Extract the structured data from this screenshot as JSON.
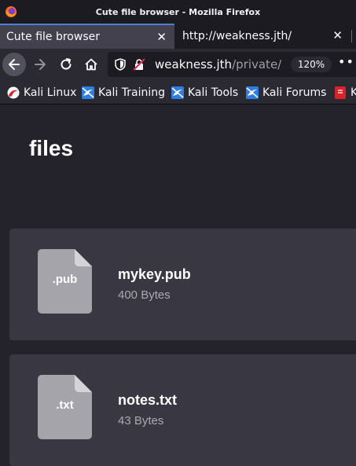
{
  "window": {
    "title": "Cute file browser - Mozilla Firefox"
  },
  "tabs": [
    {
      "label": "Cute file browser",
      "active": true
    },
    {
      "label": "http://weakness.jth/",
      "active": false
    }
  ],
  "urlbar": {
    "host": "weakness.jth",
    "path": "/private/",
    "zoom": "120%",
    "more": "•••"
  },
  "bookmarks": [
    {
      "label": "Kali Linux",
      "icon": "kali-linux-icon"
    },
    {
      "label": "Kali Training",
      "icon": "kali-training-icon"
    },
    {
      "label": "Kali Tools",
      "icon": "kali-tools-icon"
    },
    {
      "label": "Kali Forums",
      "icon": "kali-forums-icon"
    },
    {
      "label": "K",
      "icon": "kali-docs-icon"
    }
  ],
  "page": {
    "title": "files",
    "files": [
      {
        "ext": ".pub",
        "name": "mykey.pub",
        "size": "400 Bytes"
      },
      {
        "ext": ".txt",
        "name": "notes.txt",
        "size": "43 Bytes"
      }
    ]
  },
  "colors": {
    "accent": "#4a7fd4",
    "card": "#393842",
    "file_icon": "#a4a4aa"
  }
}
